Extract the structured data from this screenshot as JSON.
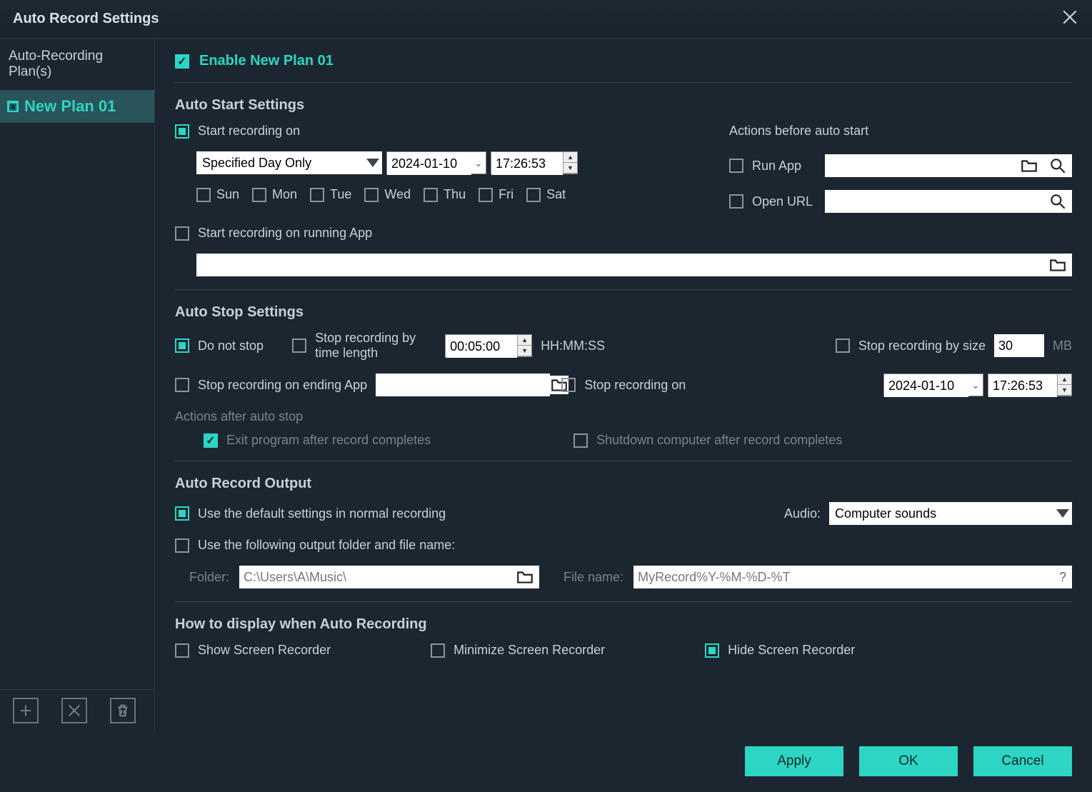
{
  "titlebar": {
    "title": "Auto Record Settings"
  },
  "sidebar": {
    "header": "Auto-Recording Plan(s)",
    "plans": [
      {
        "label": "New Plan 01"
      }
    ]
  },
  "enable": {
    "label": "Enable New Plan 01"
  },
  "autoStart": {
    "heading": "Auto Start Settings",
    "startOn": {
      "label": "Start recording on",
      "mode": "Specified Day Only",
      "date": "2024-01-10",
      "time": "17:26:53"
    },
    "days": {
      "sun": "Sun",
      "mon": "Mon",
      "tue": "Tue",
      "wed": "Wed",
      "thu": "Thu",
      "fri": "Fri",
      "sat": "Sat"
    },
    "actionsHeading": "Actions before auto start",
    "runApp": {
      "label": "Run App",
      "value": ""
    },
    "openUrl": {
      "label": "Open URL",
      "value": ""
    },
    "startOnRunningApp": {
      "label": "Start recording on running App",
      "value": ""
    }
  },
  "autoStop": {
    "heading": "Auto Stop Settings",
    "doNotStop": "Do not stop",
    "byTime": {
      "label": "Stop recording by time length",
      "value": "00:05:00",
      "suffix": "HH:MM:SS"
    },
    "bySize": {
      "label": "Stop recording by size",
      "value": "30",
      "suffix": "MB"
    },
    "onEndingApp": {
      "label": "Stop recording on ending App",
      "value": ""
    },
    "onDate": {
      "label": "Stop recording on",
      "date": "2024-01-10",
      "time": "17:26:53"
    },
    "afterHeading": "Actions after auto stop",
    "exitProgram": "Exit program after record completes",
    "shutdown": "Shutdown computer after record completes"
  },
  "output": {
    "heading": "Auto Record Output",
    "useDefault": "Use the default settings in normal recording",
    "audioLabel": "Audio:",
    "audioValue": "Computer sounds",
    "useFolder": "Use the following output folder and file name:",
    "folderLabel": "Folder:",
    "folderValue": "C:\\Users\\A\\Music\\",
    "fileLabel": "File name:",
    "fileValue": "MyRecord%Y-%M-%D-%T"
  },
  "display": {
    "heading": "How to display when Auto Recording",
    "show": "Show Screen Recorder",
    "minimize": "Minimize Screen Recorder",
    "hide": "Hide Screen Recorder"
  },
  "buttons": {
    "apply": "Apply",
    "ok": "OK",
    "cancel": "Cancel"
  }
}
